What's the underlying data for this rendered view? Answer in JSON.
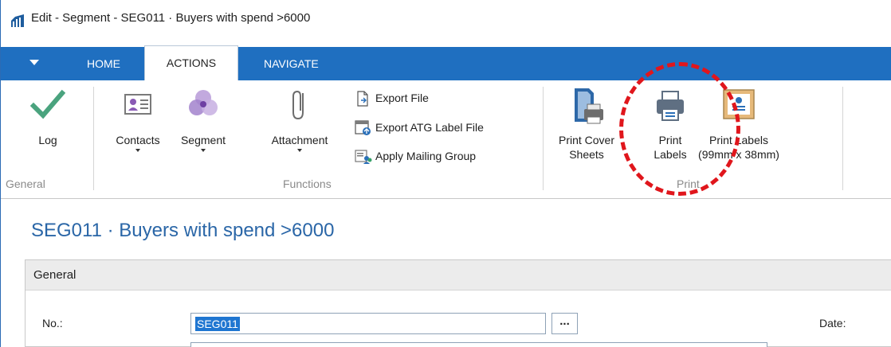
{
  "window": {
    "title": "Edit - Segment - SEG011 · Buyers with spend >6000",
    "icon": "dynamics-nav-icon"
  },
  "tabs": {
    "menu_icon": "dropdown-triangle-icon",
    "home": "HOME",
    "actions": "ACTIONS",
    "navigate": "NAVIGATE",
    "active": "ACTIONS",
    "bar_color": "#1f6fc0"
  },
  "ribbon": {
    "groups": {
      "general": "General",
      "functions": "Functions",
      "print": "Print"
    },
    "log": "Log",
    "contacts": "Contacts",
    "segment": "Segment",
    "attachment": "Attachment",
    "export_file": "Export File",
    "export_atg": "Export ATG Label File",
    "apply_mailing": "Apply Mailing Group",
    "print_cover_line1": "Print Cover",
    "print_cover_line2": "Sheets",
    "print_labels_line1": "Print",
    "print_labels_line2": "Labels",
    "print_labels99_line1": "Print Labels",
    "print_labels99_line2": "(99mm x 38mm)",
    "highlight_color": "#e0161c"
  },
  "page": {
    "title": "SEG011 · Buyers with spend >6000",
    "fasttab_general": "General",
    "no_label": "No.:",
    "no_value": "SEG011",
    "lookup_label": "...",
    "date_label": "Date:"
  }
}
